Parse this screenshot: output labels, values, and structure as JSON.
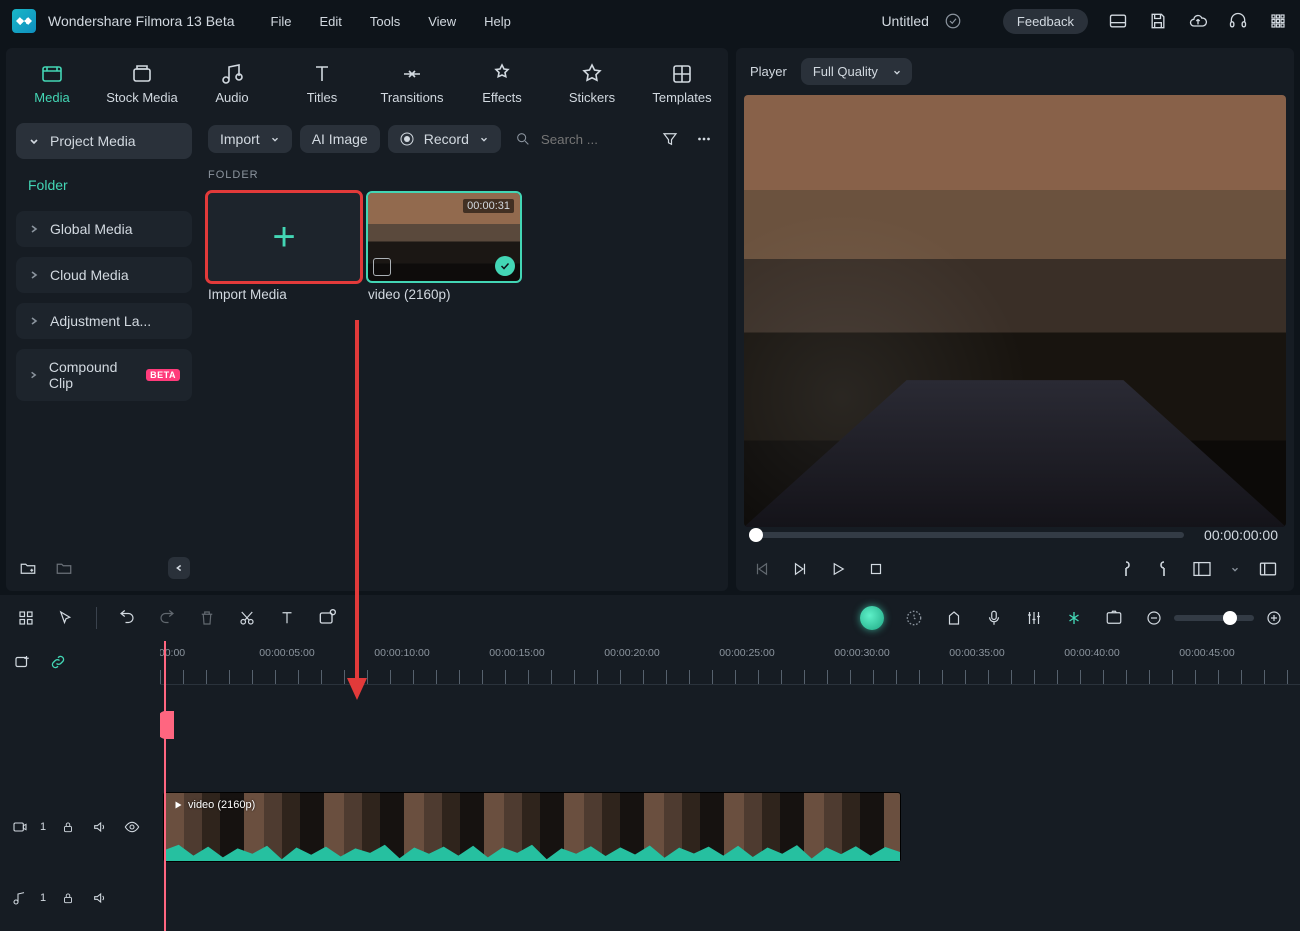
{
  "app_title": "Wondershare Filmora 13 Beta",
  "menus": [
    "File",
    "Edit",
    "Tools",
    "View",
    "Help"
  ],
  "doc_title": "Untitled",
  "feedback_label": "Feedback",
  "tabs": [
    {
      "key": "media",
      "label": "Media"
    },
    {
      "key": "stock",
      "label": "Stock Media"
    },
    {
      "key": "audio",
      "label": "Audio"
    },
    {
      "key": "titles",
      "label": "Titles"
    },
    {
      "key": "transitions",
      "label": "Transitions"
    },
    {
      "key": "effects",
      "label": "Effects"
    },
    {
      "key": "stickers",
      "label": "Stickers"
    },
    {
      "key": "templates",
      "label": "Templates"
    }
  ],
  "sidebar": {
    "project_media": "Project Media",
    "folder": "Folder",
    "global_media": "Global Media",
    "cloud_media": "Cloud Media",
    "adjustment": "Adjustment La...",
    "compound": "Compound Clip",
    "compound_badge": "BETA"
  },
  "toolbar": {
    "import": "Import",
    "ai_image": "AI Image",
    "record": "Record",
    "search_placeholder": "Search ..."
  },
  "section_title": "FOLDER",
  "cards": {
    "import_label": "Import Media",
    "video_label": "video (2160p)",
    "video_duration": "00:00:31"
  },
  "player": {
    "title": "Player",
    "quality": "Full Quality",
    "timecode": "00:00:00:00"
  },
  "timeline": {
    "ticks": [
      "00:00",
      "00:00:05:00",
      "00:00:10:00",
      "00:00:15:00",
      "00:00:20:00",
      "00:00:25:00",
      "00:00:30:00",
      "00:00:35:00",
      "00:00:40:00",
      "00:00:45:00"
    ],
    "clip_label": "video (2160p)",
    "video_track_num": "1",
    "audio_track_num": "1"
  }
}
